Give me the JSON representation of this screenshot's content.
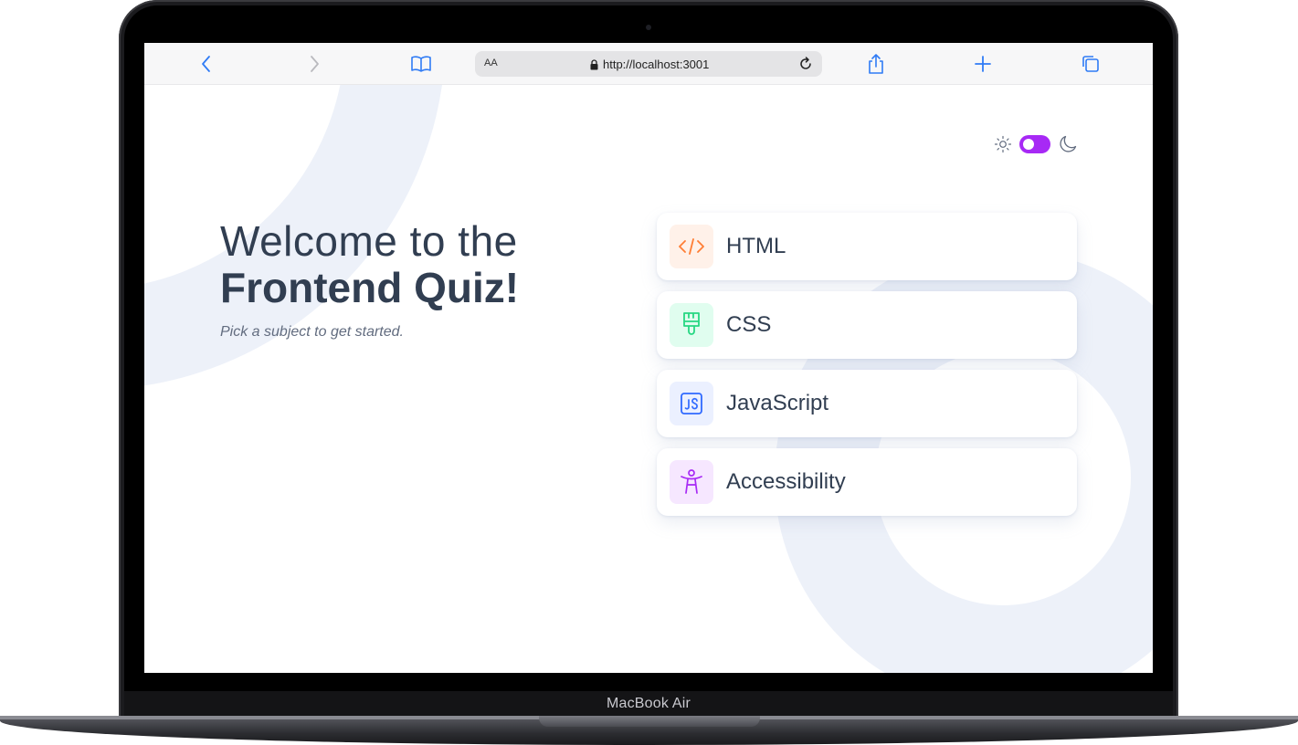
{
  "device": {
    "label": "MacBook Air"
  },
  "browser": {
    "text_size_label": "AA",
    "url": "http://localhost:3001",
    "icons": [
      "back-icon",
      "forward-icon",
      "bookmarks-icon",
      "lock-icon",
      "reload-icon",
      "share-icon",
      "new-tab-icon",
      "tabs-icon"
    ]
  },
  "theme": {
    "mode": "light",
    "light_icon": "sun-icon",
    "dark_icon": "moon-icon",
    "accent": "#a729f5"
  },
  "hero": {
    "title_line1": "Welcome to the",
    "title_line2": "Frontend Quiz!",
    "subtitle": "Pick a subject to get started."
  },
  "subjects": [
    {
      "label": "HTML",
      "icon": "code-icon",
      "icon_color": "#ff7e35",
      "icon_bg": "#fff1e9"
    },
    {
      "label": "CSS",
      "icon": "paintbrush-icon",
      "icon_color": "#26d782",
      "icon_bg": "#e0fdef"
    },
    {
      "label": "JavaScript",
      "icon": "js-icon",
      "icon_color": "#306aff",
      "icon_bg": "#ebf0ff"
    },
    {
      "label": "Accessibility",
      "icon": "accessibility-icon",
      "icon_color": "#a729f5",
      "icon_bg": "#f6e7ff"
    }
  ]
}
